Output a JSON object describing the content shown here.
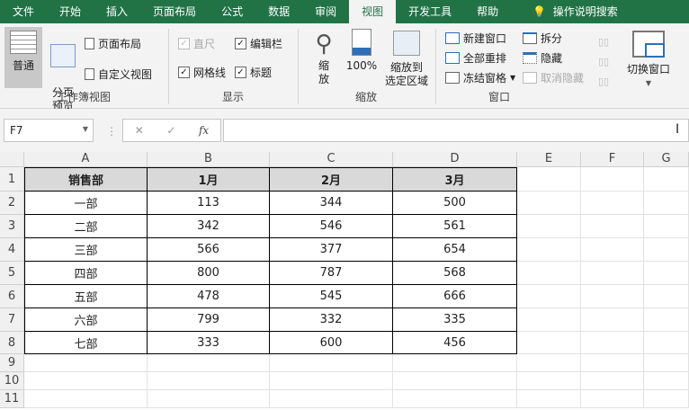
{
  "tabs": [
    "文件",
    "开始",
    "插入",
    "页面布局",
    "公式",
    "数据",
    "审阅",
    "视图",
    "开发工具",
    "帮助"
  ],
  "active_tab": "视图",
  "search_label": "操作说明搜索",
  "ribbon": {
    "workbook_views": {
      "label": "工作簿视图",
      "normal": "普通",
      "page_break": "分页\n预览",
      "page_layout": "页面布局",
      "custom_views": "自定义视图"
    },
    "show": {
      "label": "显示",
      "ruler": "直尺",
      "formula_bar": "编辑栏",
      "gridlines": "网格线",
      "headings": "标题"
    },
    "zoom": {
      "label": "缩放",
      "zoom": "缩\n放",
      "zoom100": "100%",
      "zoom_selection": "缩放到\n选定区域"
    },
    "window": {
      "label": "窗口",
      "new_window": "新建窗口",
      "arrange_all": "全部重排",
      "freeze_panes": "冻结窗格",
      "split": "拆分",
      "hide": "隐藏",
      "unhide": "取消隐藏",
      "switch_windows": "切换窗口"
    }
  },
  "formula_bar": {
    "name_box": "F7",
    "fx": "fx",
    "value": ""
  },
  "columns": [
    "A",
    "B",
    "C",
    "D",
    "E",
    "F",
    "G"
  ],
  "rows": [
    "1",
    "2",
    "3",
    "4",
    "5",
    "6",
    "7",
    "8",
    "9",
    "10",
    "11"
  ],
  "table": {
    "headers": [
      "销售部",
      "1月",
      "2月",
      "3月"
    ],
    "rows": [
      [
        "一部",
        "113",
        "344",
        "500"
      ],
      [
        "二部",
        "342",
        "546",
        "561"
      ],
      [
        "三部",
        "566",
        "377",
        "654"
      ],
      [
        "四部",
        "800",
        "787",
        "568"
      ],
      [
        "五部",
        "478",
        "545",
        "666"
      ],
      [
        "六部",
        "799",
        "332",
        "335"
      ],
      [
        "七部",
        "333",
        "600",
        "456"
      ]
    ]
  },
  "colors": {
    "accent": "#217346",
    "header_fill": "#d9d9d9"
  }
}
